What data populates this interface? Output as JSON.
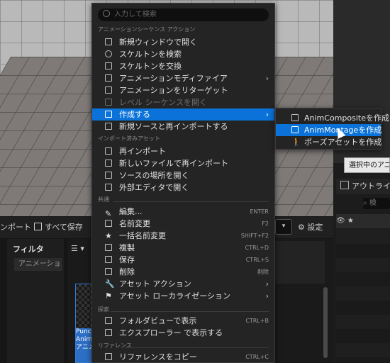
{
  "context_menu": {
    "search_placeholder": "入力して検索",
    "sections": {
      "animation_sequence": "アニメーションシーケンス アクション",
      "reimport": "インポート済みアセット",
      "common": "共通",
      "explore": "探索",
      "references": "リファレンス"
    },
    "items": {
      "open_new_window": "新規ウィンドウで開く",
      "find_skeleton": "スケルトンを検索",
      "replace_skeleton": "スケルトンを交換",
      "anim_modifier": "アニメーションモディファイア",
      "retarget": "アニメーションをリターゲット",
      "open_level_sequence": "レベル シーケンスを開く",
      "create": "作成する",
      "reimport_new_source": "新規ソースと再インポートする",
      "reimport": "再インポート",
      "reimport_new_file": "新しいファイルで再インポート",
      "open_source_location": "ソースの場所を開く",
      "open_external_editor": "外部エディタで開く",
      "edit": "編集...",
      "rename": "名前変更",
      "bulk_rename": "一括名前変更",
      "duplicate": "複製",
      "save": "保存",
      "delete": "削除",
      "asset_actions": "アセット アクション",
      "asset_localization": "アセット ローカライゼーション",
      "show_in_folder_view": "フォルダビューで表示",
      "show_in_explorer": "エクスプローラー で表示する",
      "copy_reference": "リファレンスをコピー"
    },
    "shortcuts": {
      "edit": "ENTER",
      "rename": "F2",
      "bulk_rename": "SHIFT+F2",
      "duplicate": "CTRL+D",
      "save": "CTRL+S",
      "delete": "削除",
      "show_in_folder_view": "CTRL+B",
      "copy_reference": "CTRL+C"
    }
  },
  "submenu": {
    "items": {
      "anim_composite": "AnimCompositeを作成",
      "anim_montage": "AnimMontageを作成",
      "pose_asset": "ポーズアセットを作成"
    }
  },
  "tooltip": "選択中のアニメ",
  "outliner": {
    "tab": "アウトライナ",
    "search": "検"
  },
  "toolbar": {
    "import": "ンポート",
    "save_all": "すべて保存",
    "settings": "設定"
  },
  "filter": {
    "title": "フィルタ",
    "item": "アニメーショ"
  },
  "asset_card": {
    "label_line1": "Punc",
    "label_line2": "Anim",
    "label_line3": "アニメ"
  },
  "colors": {
    "highlight": "#0a72d8",
    "menu_bg": "#242424"
  }
}
